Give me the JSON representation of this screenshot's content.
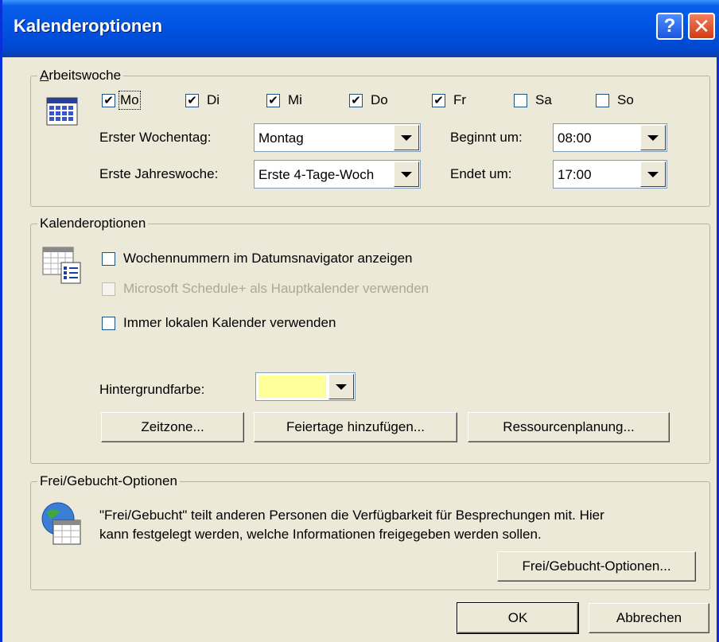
{
  "window": {
    "title": "Kalenderoptionen",
    "help_glyph": "?",
    "close_glyph": "✕"
  },
  "arbeitswoche": {
    "legend": "Arbeitswoche",
    "days": [
      {
        "label": "Mo",
        "checked": true
      },
      {
        "label": "Di",
        "checked": true
      },
      {
        "label": "Mi",
        "checked": true
      },
      {
        "label": "Do",
        "checked": true
      },
      {
        "label": "Fr",
        "checked": true
      },
      {
        "label": "Sa",
        "checked": false
      },
      {
        "label": "So",
        "checked": false
      }
    ],
    "erster_wochentag_label": "Erster Wochentag:",
    "erster_wochentag_value": "Montag",
    "erste_jahreswoche_label": "Erste Jahreswoche:",
    "erste_jahreswoche_value": "Erste 4-Tage-Woch",
    "beginnt_label": "Beginnt um:",
    "beginnt_value": "08:00",
    "endet_label": "Endet um:",
    "endet_value": "17:00"
  },
  "kalenderoptionen": {
    "legend": "Kalenderoptionen",
    "wochennummern_label": "Wochennummern im Datumsnavigator anzeigen",
    "wochennummern_checked": false,
    "schedule_label": "Microsoft Schedule+ als Hauptkalender verwenden",
    "schedule_checked": false,
    "lokal_label": "Immer lokalen Kalender verwenden",
    "lokal_checked": false,
    "hintergrund_label": "Hintergrundfarbe:",
    "hintergrund_color": "#ffff99",
    "zeitzone_button": "Zeitzone...",
    "feiertage_button": "Feiertage hinzufügen...",
    "ressourcen_button": "Ressourcenplanung..."
  },
  "freigebucht": {
    "legend": "Frei/Gebucht-Optionen",
    "description_line1": "\"Frei/Gebucht\" teilt anderen Personen die Verfügbarkeit für Besprechungen mit. Hier",
    "description_line2": "kann festgelegt werden, welche Informationen freigegeben werden sollen.",
    "options_button": "Frei/Gebucht-Optionen..."
  },
  "footer": {
    "ok": "OK",
    "cancel": "Abbrechen"
  }
}
